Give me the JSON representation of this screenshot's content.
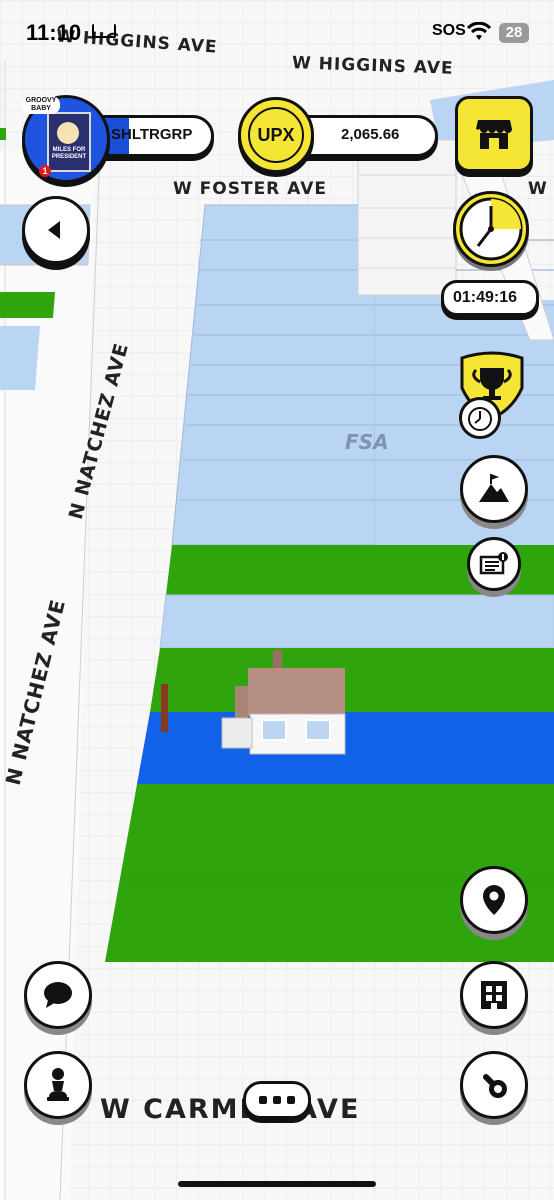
{
  "status_bar": {
    "time": "11:10",
    "sos": "SOS",
    "battery": "28"
  },
  "streets": {
    "higgins_1": "W HIGGINS AVE",
    "higgins_2": "W HIGGINS AVE",
    "foster": "W FOSTER AVE",
    "foster_cut": "W F",
    "natchez_1": "N NATCHEZ AVE",
    "natchez_2": "N NATCHEZ AVE",
    "carmen": "W CARMEN AVE"
  },
  "neighborhood_label": "FSA",
  "player": {
    "username": "SHLTRGRP",
    "avatar_caption_top": "GROOVY BABY",
    "avatar_caption": "MILES FOR PRESIDENT",
    "badge_count": "1"
  },
  "currency": {
    "label": "UPX",
    "balance": "2,065.66"
  },
  "timer": {
    "value": "01:49:16"
  },
  "icons": {
    "back": "back-arrow-icon",
    "shop": "storefront-icon",
    "clock": "clock-icon",
    "trophy": "trophy-icon",
    "mountain": "mountain-flag-icon",
    "news": "newspaper-icon",
    "location": "location-pin-icon",
    "buildings": "building-icon",
    "chat": "chat-bubble-icon",
    "pawn": "chess-pawn-icon",
    "more": "more-dots-icon",
    "search": "search-icon"
  },
  "colors": {
    "land_owned_green": "#2fa40c",
    "land_blue": "#bad5f3",
    "land_selected": "#1162e8",
    "accent_yellow": "#f5e636",
    "outline": "#111111"
  }
}
